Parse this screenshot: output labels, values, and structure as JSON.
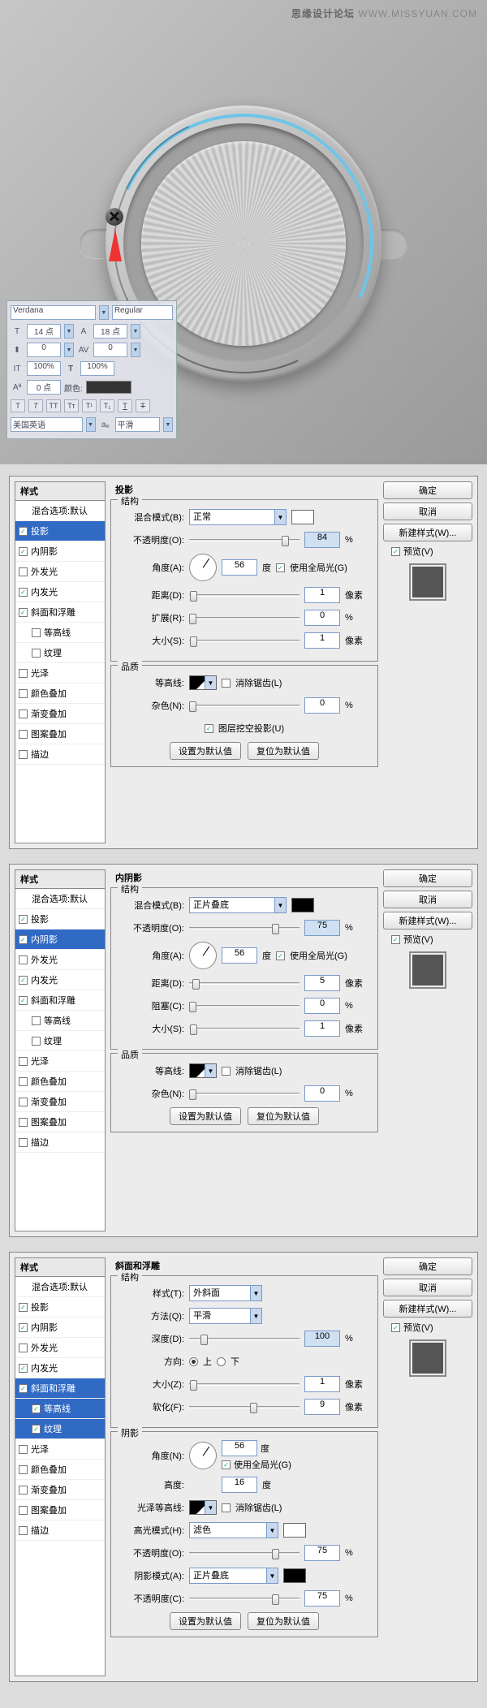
{
  "watermark": {
    "brand": "思缘设计论坛",
    "url": "WWW.MISSYUAN.COM"
  },
  "char_panel": {
    "font": "Verdana",
    "style": "Regular",
    "size": "14 点",
    "leading": "18 点",
    "vscale": "0",
    "baseline": "0",
    "pct1": "100%",
    "pct2": "100%",
    "tracking": "0 点",
    "color_label": "颜色:",
    "lang": "美国英语",
    "aa": "平滑"
  },
  "common_styles": {
    "header": "样式",
    "defaults": "混合选项:默认",
    "items": [
      "投影",
      "内阴影",
      "外发光",
      "内发光",
      "斜面和浮雕",
      "等高线",
      "纹理",
      "光泽",
      "颜色叠加",
      "渐变叠加",
      "图案叠加",
      "描边"
    ]
  },
  "common_right": {
    "ok": "确定",
    "cancel": "取消",
    "new_style": "新建样式(W)...",
    "preview": "预览(V)"
  },
  "dialog1": {
    "selected": "投影",
    "checked": [
      "投影",
      "内阴影",
      "内发光",
      "斜面和浮雕"
    ],
    "title": "投影",
    "sect_structure": "结构",
    "sect_quality": "品质",
    "blend_label": "混合模式(B):",
    "blend_value": "正常",
    "opacity_label": "不透明度(O):",
    "opacity_value": "84",
    "angle_label": "角度(A):",
    "angle_value": "56",
    "angle_unit": "度",
    "global_light": "使用全局光(G)",
    "distance_label": "距离(D):",
    "distance_value": "1",
    "distance_unit": "像素",
    "spread_label": "扩展(R):",
    "spread_value": "0",
    "spread_unit": "%",
    "size_label": "大小(S):",
    "size_value": "1",
    "size_unit": "像素",
    "contour_label": "等高线:",
    "aa_label": "消除锯齿(L)",
    "noise_label": "杂色(N):",
    "noise_value": "0",
    "noise_unit": "%",
    "knockout": "图层挖空投影(U)",
    "btn_default": "设置为默认值",
    "btn_reset": "复位为默认值"
  },
  "dialog2": {
    "selected": "内阴影",
    "checked": [
      "投影",
      "内阴影",
      "内发光",
      "斜面和浮雕"
    ],
    "title": "内阴影",
    "sect_structure": "结构",
    "sect_quality": "品质",
    "blend_label": "混合模式(B):",
    "blend_value": "正片叠底",
    "opacity_label": "不透明度(O):",
    "opacity_value": "75",
    "angle_label": "角度(A):",
    "angle_value": "56",
    "angle_unit": "度",
    "global_light": "使用全局光(G)",
    "distance_label": "距离(D):",
    "distance_value": "5",
    "distance_unit": "像素",
    "choke_label": "阻塞(C):",
    "choke_value": "0",
    "choke_unit": "%",
    "size_label": "大小(S):",
    "size_value": "1",
    "size_unit": "像素",
    "contour_label": "等高线:",
    "aa_label": "消除锯齿(L)",
    "noise_label": "杂色(N):",
    "noise_value": "0",
    "noise_unit": "%",
    "btn_default": "设置为默认值",
    "btn_reset": "复位为默认值"
  },
  "dialog3": {
    "selected": "斜面和浮雕",
    "checked": [
      "投影",
      "内阴影",
      "内发光",
      "斜面和浮雕",
      "等高线",
      "纹理"
    ],
    "sub_selected": [
      "等高线",
      "纹理"
    ],
    "title": "斜面和浮雕",
    "sect_structure": "结构",
    "sect_shading": "阴影",
    "style_label": "样式(T):",
    "style_value": "外斜面",
    "technique_label": "方法(Q):",
    "technique_value": "平滑",
    "depth_label": "深度(D):",
    "depth_value": "100",
    "depth_unit": "%",
    "direction_label": "方向:",
    "dir_up": "上",
    "dir_down": "下",
    "size_label": "大小(Z):",
    "size_value": "1",
    "size_unit": "像素",
    "soften_label": "软化(F):",
    "soften_value": "9",
    "soften_unit": "像素",
    "angle_label": "角度(N):",
    "angle_value": "56",
    "angle_unit": "度",
    "global_light": "使用全局光(G)",
    "altitude_label": "高度:",
    "altitude_value": "16",
    "altitude_unit": "度",
    "gloss_contour_label": "光泽等高线:",
    "aa_label": "消除锯齿(L)",
    "hl_mode_label": "高光模式(H):",
    "hl_mode_value": "滤色",
    "hl_opacity_label": "不透明度(O):",
    "hl_opacity_value": "75",
    "sh_mode_label": "阴影模式(A):",
    "sh_mode_value": "正片叠底",
    "sh_opacity_label": "不透明度(C):",
    "sh_opacity_value": "75",
    "btn_default": "设置为默认值",
    "btn_reset": "复位为默认值"
  }
}
